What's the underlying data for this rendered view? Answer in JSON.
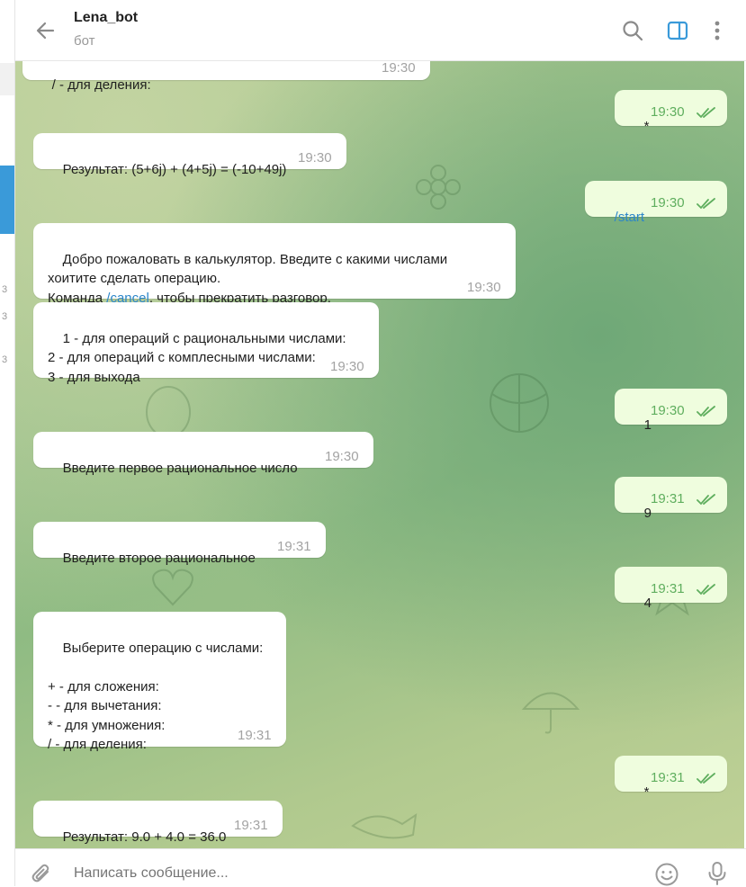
{
  "sidebar": {
    "digits": [
      "3",
      "3",
      "3"
    ]
  },
  "header": {
    "title": "Lena_bot",
    "subtitle": "бот"
  },
  "messages": [
    {
      "dir": "in",
      "text": "/ - для деления:",
      "time": "19:30"
    },
    {
      "dir": "out",
      "text": "*",
      "time": "19:30"
    },
    {
      "dir": "in",
      "text": "Результат: (5+6j) + (4+5j) = (-10+49j)",
      "time": "19:30"
    },
    {
      "dir": "out",
      "text": "/start",
      "time": "19:30"
    },
    {
      "dir": "in",
      "text_before": "Добро пожаловать в калькулятор. Введите с какими числами\nхоитите сделать операцию.\nКоманда ",
      "command": "/cancel",
      "text_after": ", чтобы прекратить разговор.",
      "time": "19:30"
    },
    {
      "dir": "in",
      "text": "1 - для операций с рациональными числами:\n2 - для операций с комплесными числами:\n3 - для выхода",
      "time": "19:30"
    },
    {
      "dir": "out",
      "text": "1",
      "time": "19:30"
    },
    {
      "dir": "in",
      "text": "Введите первое рациональное число",
      "time": "19:30"
    },
    {
      "dir": "out",
      "text": "9",
      "time": "19:31"
    },
    {
      "dir": "in",
      "text": "Введите второе рациональное",
      "time": "19:31"
    },
    {
      "dir": "out",
      "text": "4",
      "time": "19:31"
    },
    {
      "dir": "in",
      "text": "Выберите операцию с числами:\n\n+ - для сложения:\n- - для вычетания:\n* - для умножения:\n/ - для деления:",
      "time": "19:31"
    },
    {
      "dir": "out",
      "text": "*",
      "time": "19:31"
    },
    {
      "dir": "in",
      "text": "Результат: 9.0 + 4.0 = 36.0",
      "time": "19:31"
    }
  ],
  "composer": {
    "placeholder": "Написать сообщение..."
  },
  "icons": {
    "back": "arrow-left-icon",
    "search": "search-icon",
    "sidebar_toggle": "sidebar-toggle-icon",
    "more": "more-vertical-icon",
    "attach": "paperclip-icon",
    "emoji": "emoji-icon",
    "mic": "microphone-icon",
    "read": "double-check-icon"
  },
  "colors": {
    "accent": "#3a9ad9",
    "outgoing_bubble": "#effdde",
    "read_ticks": "#5fae5e",
    "link": "#2c86c9"
  }
}
